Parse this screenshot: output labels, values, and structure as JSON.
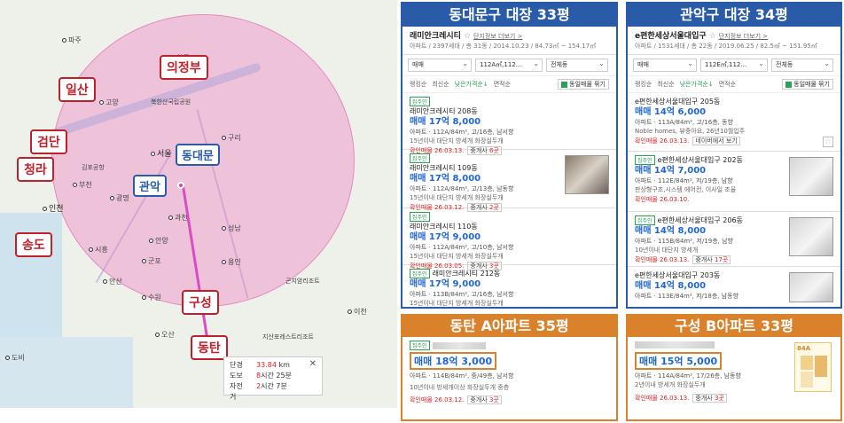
{
  "map": {
    "red_labels": [
      "의정부",
      "일산",
      "검단",
      "청라",
      "송도",
      "구성",
      "동탄"
    ],
    "blue_labels": [
      "동대문",
      "관악"
    ],
    "towns": [
      "파주",
      "양주",
      "고양",
      "북한산국립공원",
      "서울",
      "구리",
      "김포공항",
      "부천",
      "광명",
      "인천",
      "과천",
      "성남",
      "안양",
      "시흥",
      "군포",
      "안산",
      "용인",
      "수원",
      "오산",
      "이천",
      "곤지암리조트",
      "지산포레스트리조트",
      "도비"
    ],
    "distance": {
      "rows": [
        {
          "label": "단경",
          "value": "33.84",
          "unit": "km"
        },
        {
          "label": "도보",
          "value": "8",
          "unit": "시간 25분"
        },
        {
          "label": "자전거",
          "value": "2",
          "unit": "시간 7분"
        }
      ],
      "close": "✕"
    }
  },
  "panels": {
    "dongdaemun": {
      "title": "동대문구 대장 33평",
      "complex": "래미안크레시티",
      "star": "☆",
      "link": "단지정보 더보기 >",
      "meta": "아파트 / 2397세대 / 총 31동 / 2014.10.23 / 84.73㎡ ~ 154.17㎡",
      "filters": [
        "매매",
        "112A㎡,112...",
        "전체동"
      ],
      "sorts": [
        "랭킹순",
        "최신순",
        "낮은가격순↓",
        "면적순"
      ],
      "check": "동일매물 묶기",
      "listings": [
        {
          "badge": "집주인",
          "name": "래미안크레시티 208동",
          "price": "매매 17억 8,000",
          "desc": "아파트 · 112A/84m², 고/16층, 남서향",
          "tags": "15년이내  대단지  방세개  화장실두개",
          "confirm": "확인매물 26.03.13.",
          "agent": "중개사",
          "agent_count": "6곳"
        },
        {
          "badge": "집주인",
          "name": "래미안크레시티 109동",
          "price": "매매 17억 8,000",
          "desc": "아파트 · 112A/84m², 고/13층, 남동향",
          "tags": "15년이내  대단지  방세개  화장실두개",
          "confirm": "확인매물 26.03.12.",
          "agent": "중개사",
          "agent_count": "2곳"
        },
        {
          "badge": "집주인",
          "name": "래미안크레시티 110동",
          "price": "매매 17억 9,000",
          "desc": "아파트 · 112A/84m², 고/10층, 남서향",
          "tags": "15년이내  대단지  방세개  화장실두개",
          "confirm": "확인매물 26.03.05.",
          "agent": "중개사",
          "agent_count": "3곳"
        },
        {
          "badge": "집주인",
          "name": "래미안크레시티 212동",
          "price": "매매 17억 9,000",
          "desc": "아파트 · 113B/84m², 고/16층, 남서향",
          "tags": "15년이내  대단지  방세개  화장실두개",
          "confirm": "",
          "agent": "",
          "agent_count": ""
        }
      ]
    },
    "gwanak": {
      "title": "관악구 대장 34평",
      "complex": "e편한세상서울대입구",
      "star": "☆",
      "link": "단지정보 더보기 >",
      "meta": "아파트 / 1531세대 / 총 22동 / 2019.06.25 / 82.5㎡ ~ 151.95㎡",
      "filters": [
        "매매",
        "112E㎡,112...",
        "전체동"
      ],
      "sorts": [
        "랭킹순",
        "최신순",
        "낮은가격순↓",
        "면적순"
      ],
      "check": "동일매물 묶기",
      "listings": [
        {
          "badge": "",
          "name": "e편한세상서울대입구 205동",
          "price": "매매 14억 6,000",
          "desc": "아파트 · 113A/84m², 고/16층, 동향",
          "tags": "Noble homes, 뷰중아요, 26년10월입주",
          "confirm": "확인매물 26.03.13.",
          "agent": "네이버에서 보기",
          "agent_count": ""
        },
        {
          "badge": "집주인",
          "name": "e편한세상서울대입구 202동",
          "price": "매매 14억 7,000",
          "desc": "아파트 · 112E/84m², 저/19층, 남향",
          "tags": "판상형구조,시스템 에어컨, 이사일 조율",
          "confirm": "확인매물 26.03.10.",
          "agent": "",
          "agent_count": ""
        },
        {
          "badge": "집주인",
          "name": "e편한세상서울대입구 206동",
          "price": "매매 14억 8,000",
          "desc": "아파트 · 115B/84m², 저/19층, 남향",
          "tags": "10년이내  대단지  방세개",
          "confirm": "확인매물 26.03.13.",
          "agent": "중개사",
          "agent_count": "17곳"
        },
        {
          "badge": "",
          "name": "e편한세상서울대입구 203동",
          "price": "매매 14억 8,000",
          "desc": "아파트 · 113E/84m², 저/18층, 남동향",
          "tags": "",
          "confirm": "",
          "agent": "",
          "agent_count": ""
        }
      ]
    },
    "dongtan": {
      "title": "동탄 A아파트 35평",
      "badge": "집주인",
      "price": "매매 18억 3,000",
      "desc": "아파트 · 114B/84m², 중/49층, 남서향",
      "tags": "10년이내  방세개이상  화장실두개  중층",
      "confirm": "확인매물 26.03.12.",
      "agent": "중개사",
      "agent_count": "3곳"
    },
    "guseong": {
      "title": "구성 B아파트 33평",
      "price": "매매 15억 5,000",
      "desc": "아파트 · 114A/84m², 17/26층, 남동향",
      "tags": "2년이내  방세개  화장실두개",
      "confirm": "확인매물 26.03.13.",
      "agent": "중개사",
      "agent_count": "3곳",
      "floorplan_tag": "84A"
    }
  }
}
